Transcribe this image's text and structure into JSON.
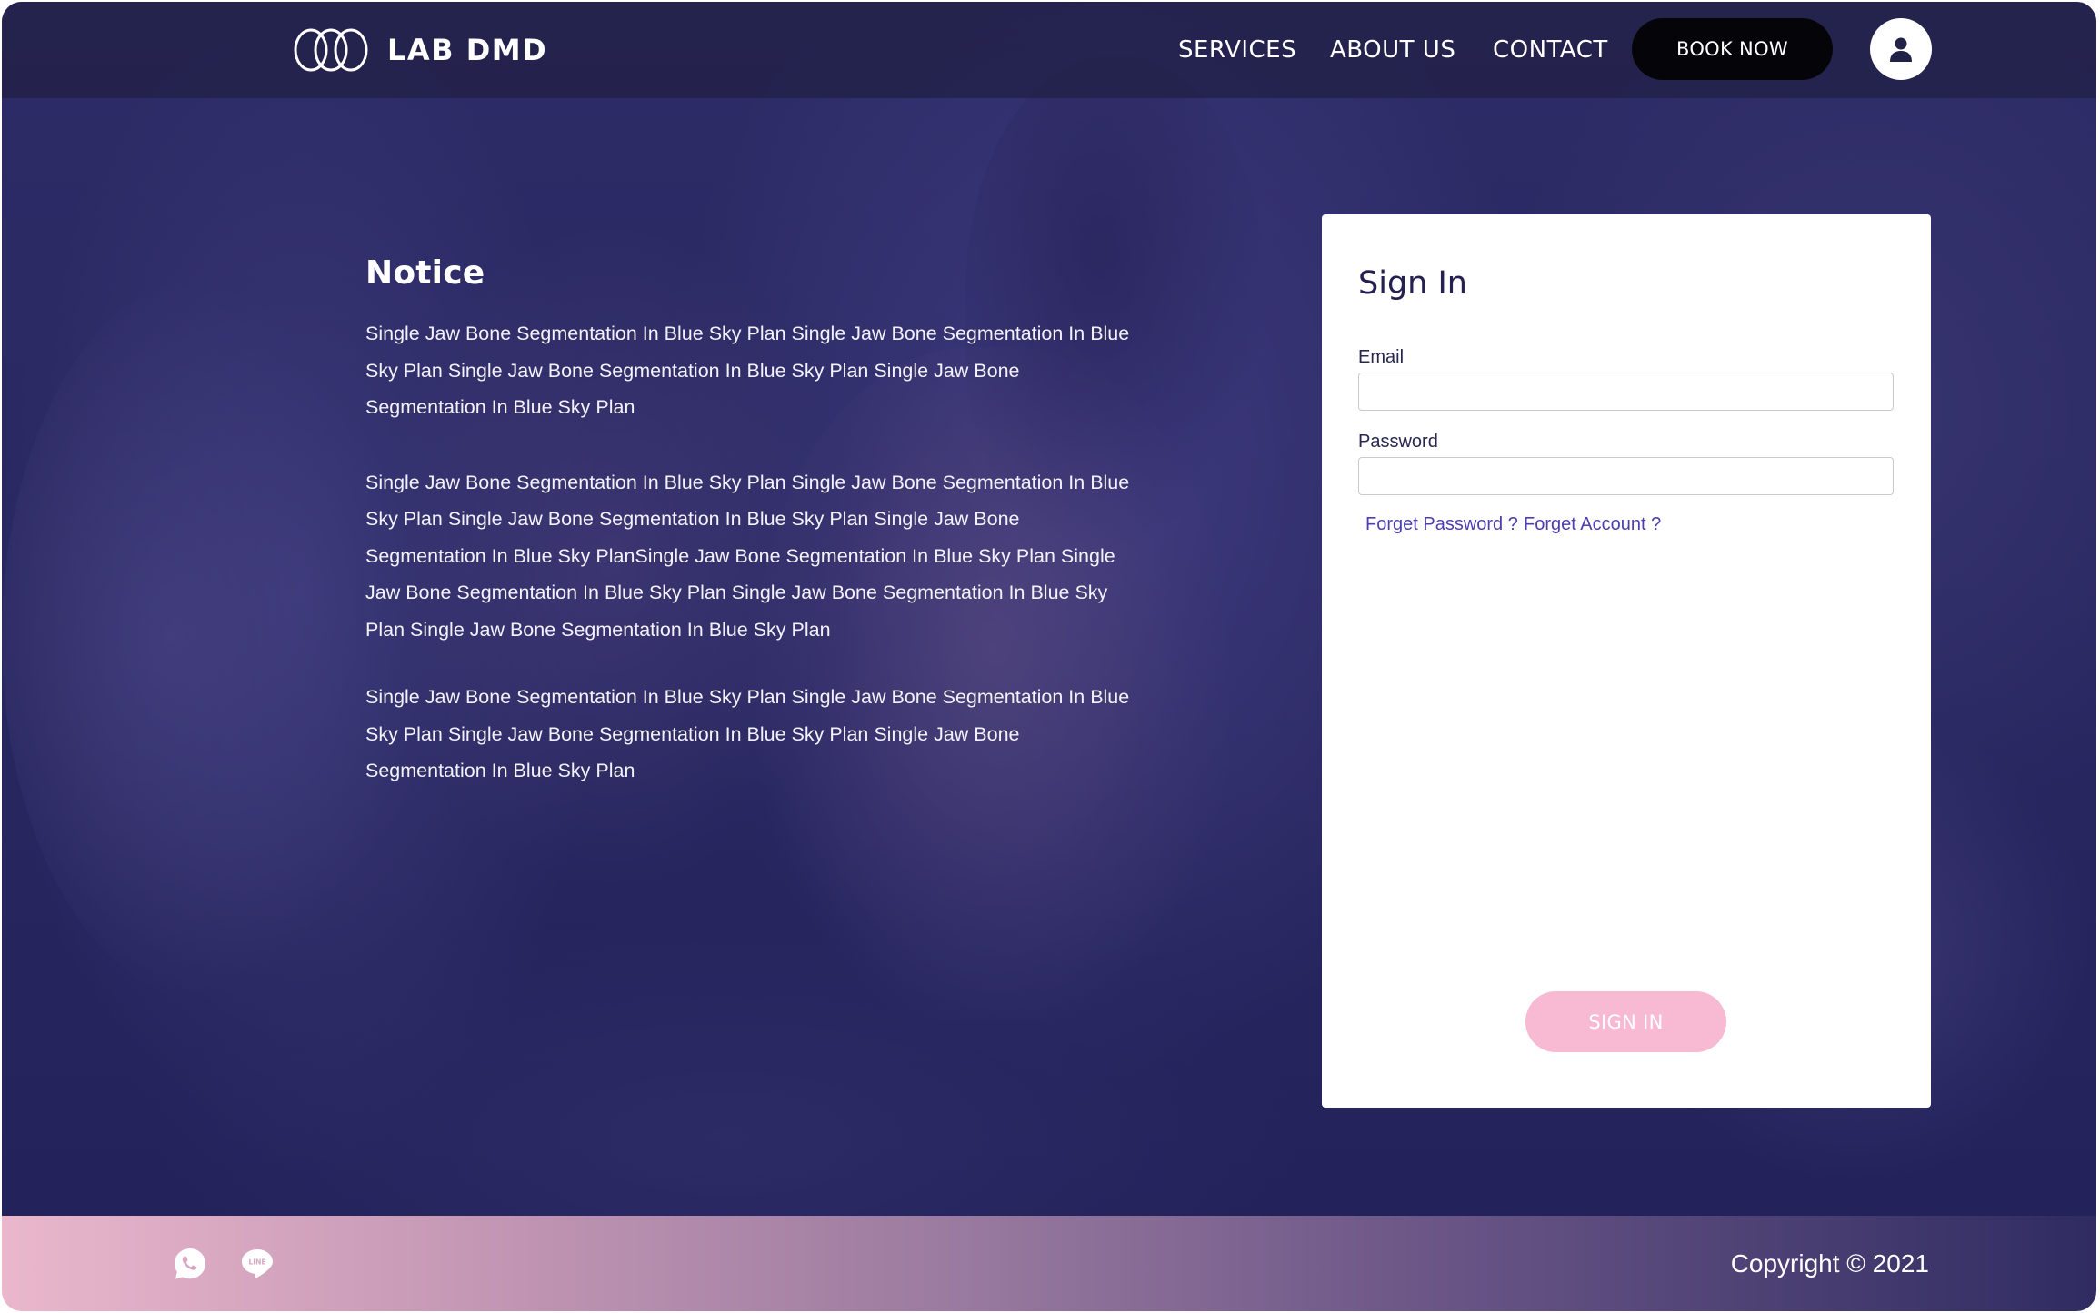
{
  "brand": {
    "name": "LAB DMD",
    "logo_icon": "three-rings-logo"
  },
  "nav": {
    "services": "SERVICES",
    "about": "ABOUT US",
    "contact": "CONTACT",
    "book_now": "BOOK NOW",
    "account_icon": "user-icon"
  },
  "notice": {
    "title": "Notice",
    "paragraphs": [
      "Single Jaw Bone Segmentation In Blue Sky Plan Single Jaw Bone Segmentation In Blue Sky Plan Single Jaw Bone Segmentation In Blue Sky Plan Single Jaw Bone Segmentation In Blue Sky Plan",
      "Single Jaw Bone Segmentation In Blue Sky Plan Single Jaw Bone Segmentation In Blue Sky Plan Single Jaw Bone Segmentation In Blue Sky Plan Single Jaw Bone Segmentation In Blue Sky PlanSingle Jaw Bone Segmentation In Blue Sky Plan Single Jaw Bone Segmentation In Blue Sky Plan Single Jaw Bone Segmentation In Blue Sky Plan Single Jaw Bone Segmentation In Blue Sky Plan",
      "Single Jaw Bone Segmentation In Blue Sky Plan Single Jaw Bone Segmentation In Blue Sky Plan Single Jaw Bone Segmentation In Blue Sky Plan Single Jaw Bone Segmentation In Blue Sky Plan"
    ]
  },
  "signin": {
    "title": "Sign In",
    "email_label": "Email",
    "email_value": "",
    "password_label": "Password",
    "password_value": "",
    "forget_password": "Forget Password ?",
    "forget_account": "Forget Account ?",
    "submit": "SIGN IN"
  },
  "footer": {
    "icons": [
      "whatsapp-icon",
      "line-icon"
    ],
    "line_icon_text": "LINE",
    "copyright": "Copyright © 2021"
  },
  "colors": {
    "background": "#2a2862",
    "header": "#222148",
    "book_button": "#050509",
    "signin_button": "#f8b9d2",
    "link": "#4b3fb0",
    "footer_start": "#eab7cc",
    "footer_end": "#2f2c62"
  }
}
